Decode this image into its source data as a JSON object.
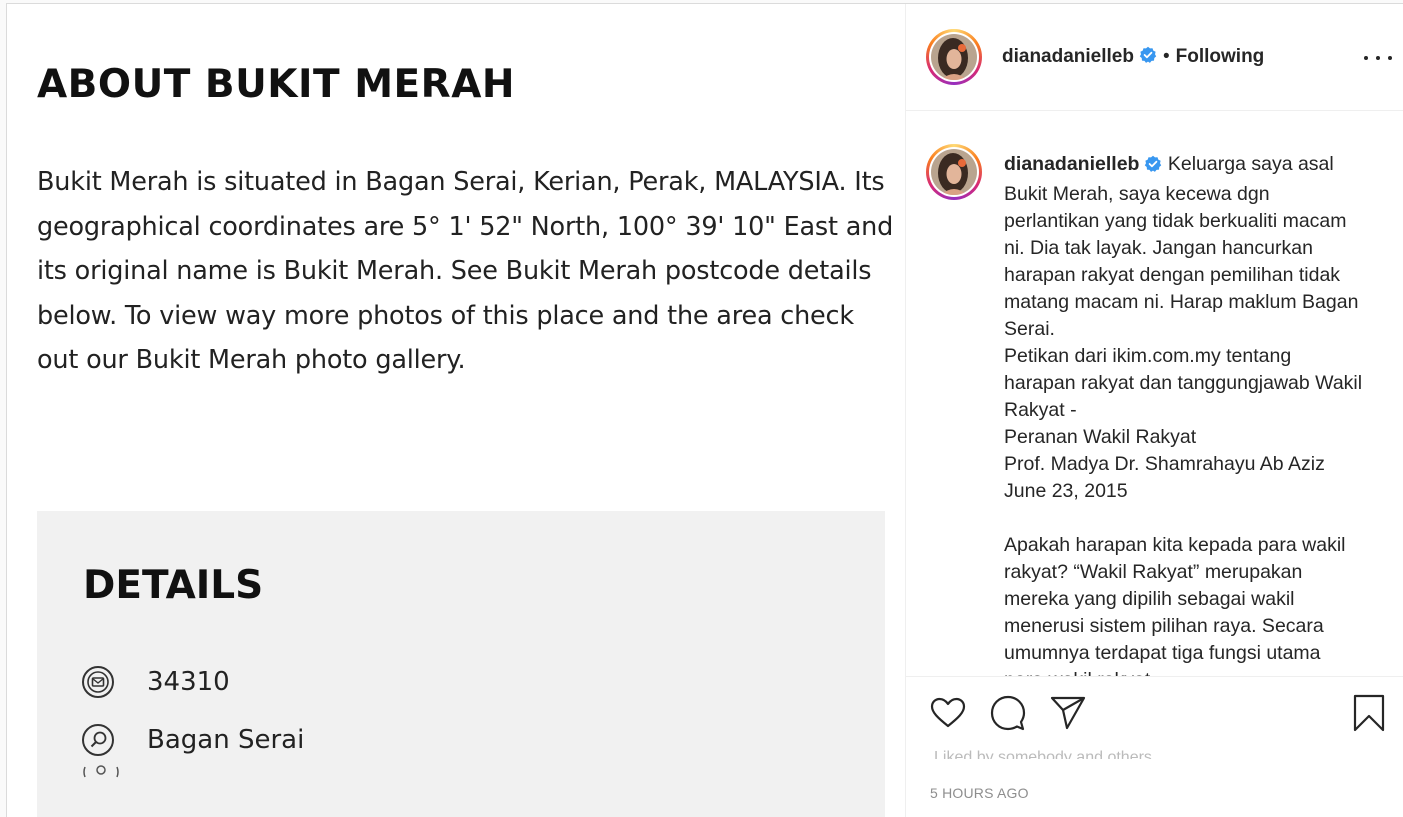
{
  "post_image": {
    "about_heading": "ABOUT BUKIT MERAH",
    "about_body": "Bukit Merah is situated in Bagan Serai, Kerian, Perak, MALAYSIA. Its geographical coordinates are 5° 1' 52\" North, 100° 39' 10\" East and its original name is Bukit Merah. See Bukit Merah postcode details below. To view way more photos of this place and the area check out our Bukit Merah photo gallery.",
    "details_heading": "DETAILS",
    "details": [
      {
        "icon": "mail-icon",
        "value": "34310"
      },
      {
        "icon": "search-icon",
        "value": "Bagan Serai"
      }
    ]
  },
  "header": {
    "username": "dianadanielleb",
    "verified": true,
    "separator": "•",
    "follow_status": "Following",
    "more_icon": "more-options-icon"
  },
  "caption": {
    "username": "dianadanielleb",
    "text": "Keluarga saya asal Bukit Merah, saya kecewa dgn perlantikan yang tidak berkualiti macam ni. Dia tak layak. Jangan hancurkan harapan rakyat dengan pemilihan tidak matang macam ni. Harap maklum Bagan Serai.\nPetikan dari ikim.com.my tentang harapan rakyat dan tanggungjawab Wakil Rakyat -\nPeranan Wakil Rakyat\nProf. Madya Dr. Shamrahayu Ab Aziz\nJune 23, 2015\n\nApakah harapan kita kepada para wakil rakyat? “Wakil Rakyat” merupakan mereka yang dipilih sebagai wakil menerusi sistem pilihan raya. Secara umumnya terdapat tiga fungsi utama para wakil rakyat"
  },
  "actions": {
    "like_icon": "heart-icon",
    "comment_icon": "comment-icon",
    "share_icon": "share-icon",
    "save_icon": "bookmark-icon",
    "likes_text": "Liked by somebody and others",
    "timestamp": "5 HOURS AGO"
  },
  "colors": {
    "text": "#262626",
    "muted": "#8e8e8e",
    "verified": "#3897f0",
    "details_bg": "#f1f1f1"
  }
}
